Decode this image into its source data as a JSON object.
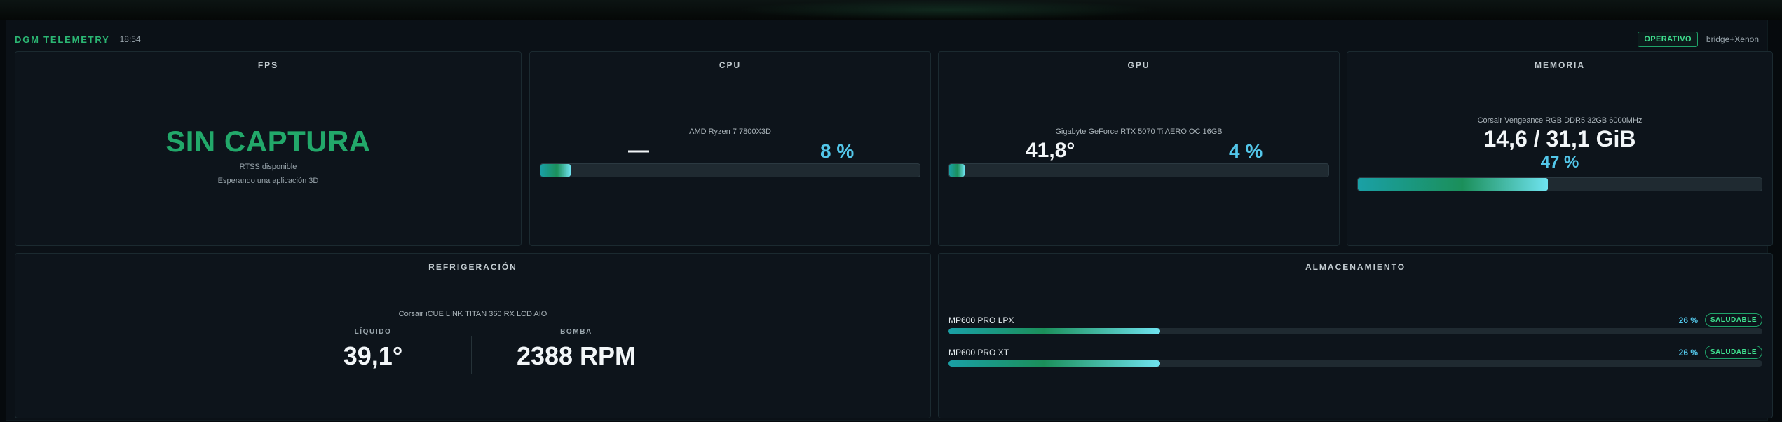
{
  "header": {
    "brand": "DGM TELEMETRY",
    "clock": "18:54",
    "status": "OPERATIVO",
    "source": "bridge+Xenon"
  },
  "fps": {
    "title": "FPS",
    "state": "SIN CAPTURA",
    "line1": "RTSS disponible",
    "line2": "Esperando una aplicación 3D"
  },
  "cpu": {
    "title": "CPU",
    "model": "AMD Ryzen 7 7800X3D",
    "temp": "—",
    "load": "8 %",
    "load_fraction": 0.08
  },
  "gpu": {
    "title": "GPU",
    "model": "Gigabyte GeForce RTX 5070 Ti AERO OC 16GB",
    "temp": "41,8°",
    "load": "4 %",
    "load_fraction": 0.04
  },
  "memory": {
    "title": "MEMORIA",
    "model": "Corsair Vengeance RGB DDR5 32GB 6000MHz",
    "usage": "14,6 / 31,1 GiB",
    "percent": "47 %",
    "fraction": 0.47
  },
  "cooling": {
    "title": "REFRIGERACIÓN",
    "model": "Corsair iCUE LINK TITAN 360 RX LCD AIO",
    "liquid_label": "LÍQUIDO",
    "liquid_value": "39,1°",
    "pump_label": "BOMBA",
    "pump_value": "2388 RPM"
  },
  "storage": {
    "title": "ALMACENAMIENTO",
    "disks": [
      {
        "name": "MP600 PRO LPX",
        "percent": "26 %",
        "fraction": 0.26,
        "status": "SALUDABLE"
      },
      {
        "name": "MP600 PRO XT",
        "percent": "26 %",
        "fraction": 0.26,
        "status": "SALUDABLE"
      }
    ]
  },
  "colors": {
    "accent_green": "#22a86a",
    "accent_cyan": "#53c7ea",
    "card_bg": "#0d141b",
    "page_bg": "#0b1117"
  }
}
